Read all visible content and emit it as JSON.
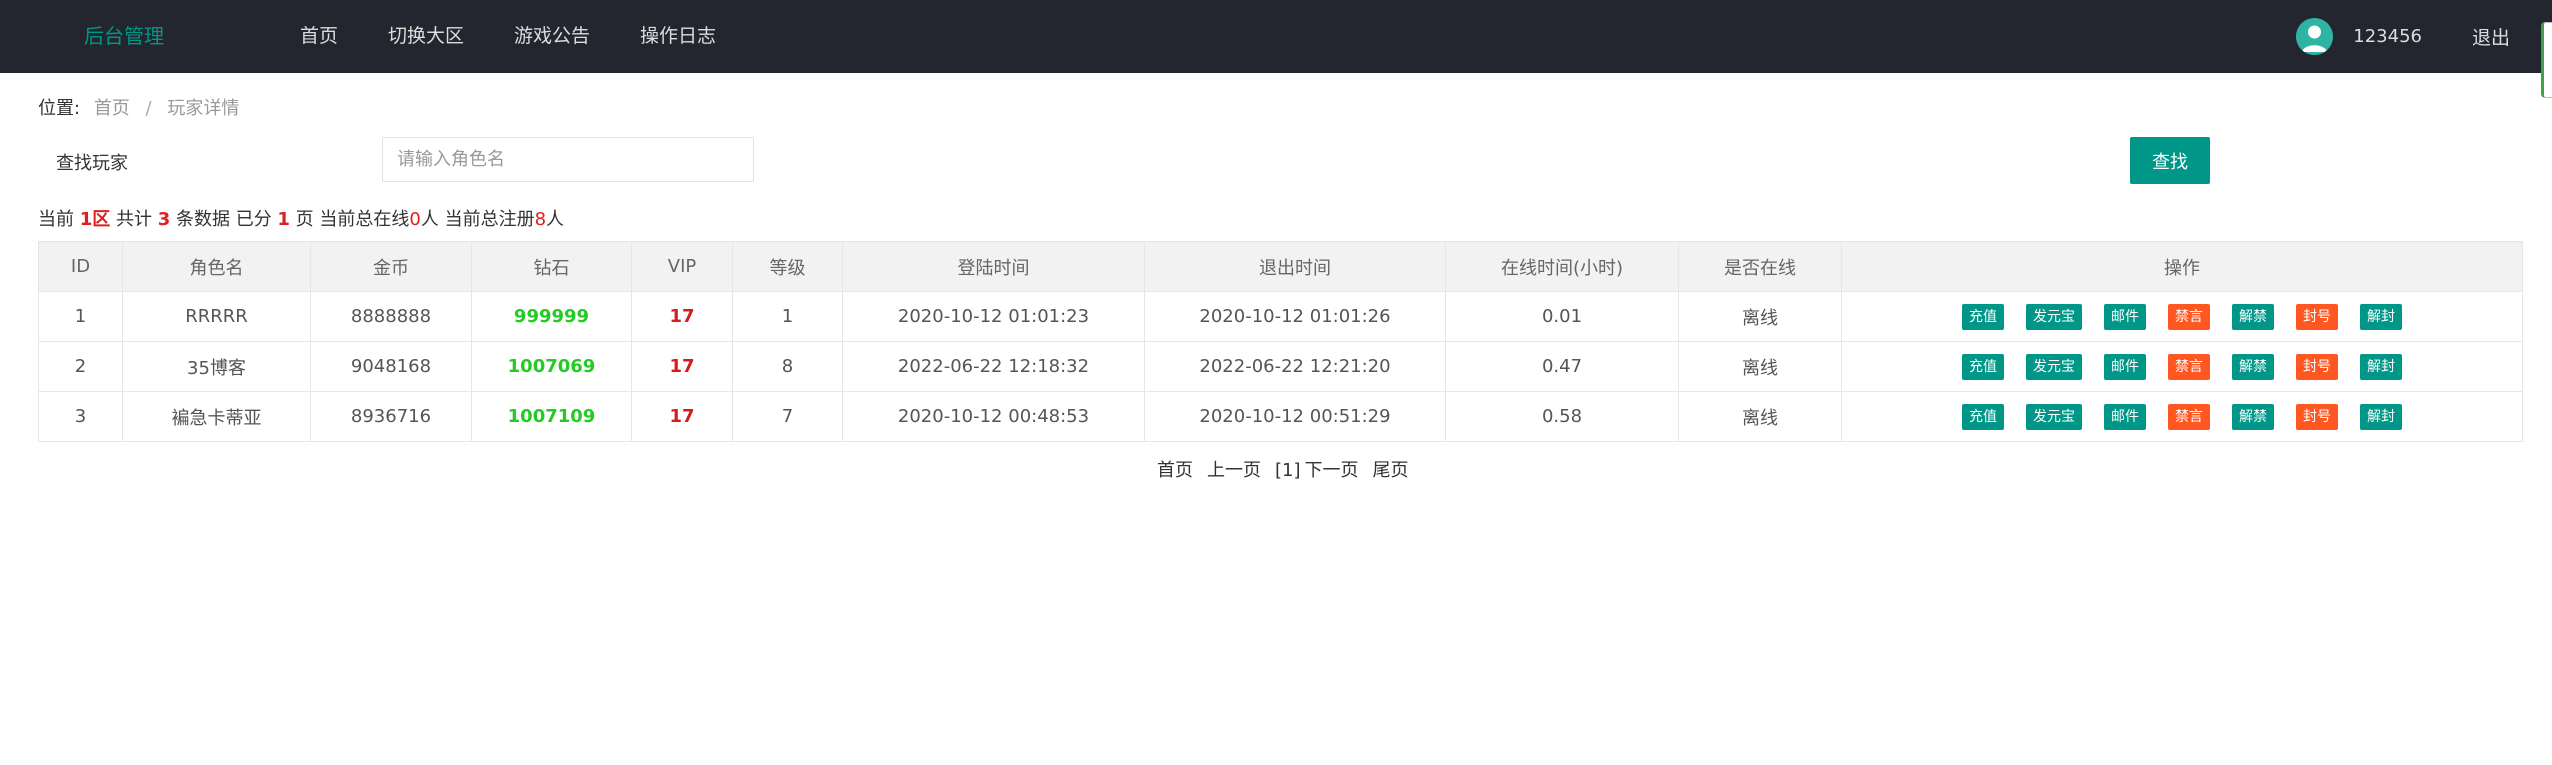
{
  "header": {
    "logo": "后台管理",
    "nav": [
      "首页",
      "切换大区",
      "游戏公告",
      "操作日志"
    ],
    "username": "123456",
    "logout": "退出"
  },
  "breadcrumb": {
    "prefix": "位置:",
    "items": [
      "首页",
      "玩家详情"
    ],
    "separator": "/"
  },
  "search": {
    "label": "查找玩家",
    "placeholder": "请输入角色名",
    "value": "",
    "button": "查找"
  },
  "summary": {
    "t1": "当前 ",
    "zone": "1区",
    "t2": " 共计 ",
    "total": "3",
    "t3": " 条数据 已分 ",
    "pages": "1",
    "t4": " 页 当前总在线",
    "online": "0",
    "t5": "人 当前总注册",
    "registered": "8",
    "t6": "人"
  },
  "table": {
    "columns": [
      "ID",
      "角色名",
      "金币",
      "钻石",
      "VIP",
      "等级",
      "登陆时间",
      "退出时间",
      "在线时间(小时)",
      "是否在线",
      "操作"
    ],
    "actions": [
      {
        "label": "充值",
        "color": "#009688"
      },
      {
        "label": "发元宝",
        "color": "#009688"
      },
      {
        "label": "邮件",
        "color": "#009688"
      },
      {
        "label": "禁言",
        "color": "#ff5722"
      },
      {
        "label": "解禁",
        "color": "#009688"
      },
      {
        "label": "封号",
        "color": "#ff5722"
      },
      {
        "label": "解封",
        "color": "#009688"
      }
    ],
    "rows": [
      {
        "id": "1",
        "name": "RRRRR",
        "gold": "8888888",
        "diamond": "999999",
        "vip": "17",
        "level": "1",
        "login": "2020-10-12 01:01:23",
        "logout": "2020-10-12 01:01:26",
        "hours": "0.01",
        "status": "离线"
      },
      {
        "id": "2",
        "name": "35博客",
        "gold": "9048168",
        "diamond": "1007069",
        "vip": "17",
        "level": "8",
        "login": "2022-06-22 12:18:32",
        "logout": "2022-06-22 12:21:20",
        "hours": "0.47",
        "status": "离线"
      },
      {
        "id": "3",
        "name": "褊急卡蒂亚",
        "gold": "8936716",
        "diamond": "1007109",
        "vip": "17",
        "level": "7",
        "login": "2020-10-12 00:48:53",
        "logout": "2020-10-12 00:51:29",
        "hours": "0.58",
        "status": "离线"
      }
    ]
  },
  "pager": {
    "first": "首页",
    "prev": "上一页",
    "current": "[1]",
    "next": "下一页",
    "last": "尾页"
  },
  "colors": {
    "topbar": "#23262e",
    "accent": "#009688",
    "danger": "#ff5722",
    "diamond": "#22cc22",
    "vip": "#d61c1c"
  },
  "icons": {
    "avatar": "user-avatar-icon"
  }
}
